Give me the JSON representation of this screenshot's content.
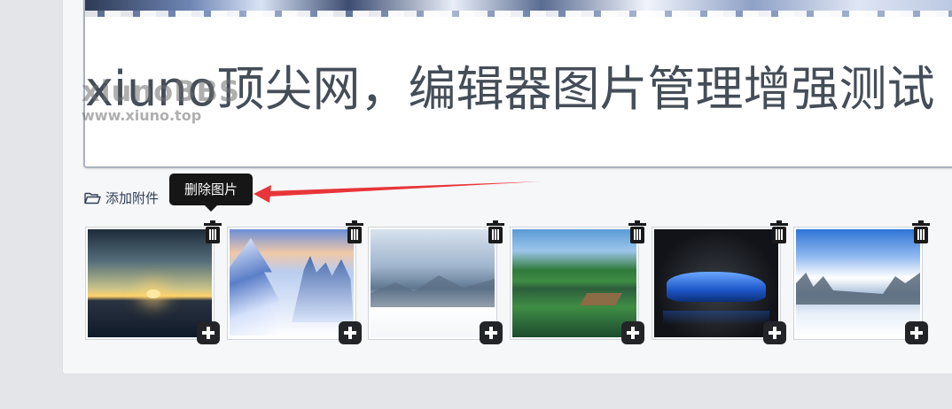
{
  "editor": {
    "headline": "xiuno顶尖网，编辑器图片管理增强测试"
  },
  "watermark": {
    "logo": "xiunoBBS",
    "url": "www.xiuno.top"
  },
  "attachments": {
    "add_label": "添加附件",
    "tooltip": "删除图片",
    "images": [
      {
        "name": "sunset-over-sea",
        "delete_icon": "trash-icon",
        "insert_icon": "plus-icon"
      },
      {
        "name": "snowy-trees",
        "delete_icon": "trash-icon",
        "insert_icon": "plus-icon"
      },
      {
        "name": "snowy-mountain",
        "delete_icon": "trash-icon",
        "insert_icon": "plus-icon"
      },
      {
        "name": "green-lake",
        "delete_icon": "trash-icon",
        "insert_icon": "plus-icon"
      },
      {
        "name": "blue-sports-car",
        "delete_icon": "trash-icon",
        "insert_icon": "plus-icon"
      },
      {
        "name": "winter-lake",
        "delete_icon": "trash-icon",
        "insert_icon": "plus-icon"
      }
    ]
  },
  "colors": {
    "annotation_arrow": "#e8353a",
    "tooltip_bg": "#161616",
    "icon_bg": "#222428"
  }
}
